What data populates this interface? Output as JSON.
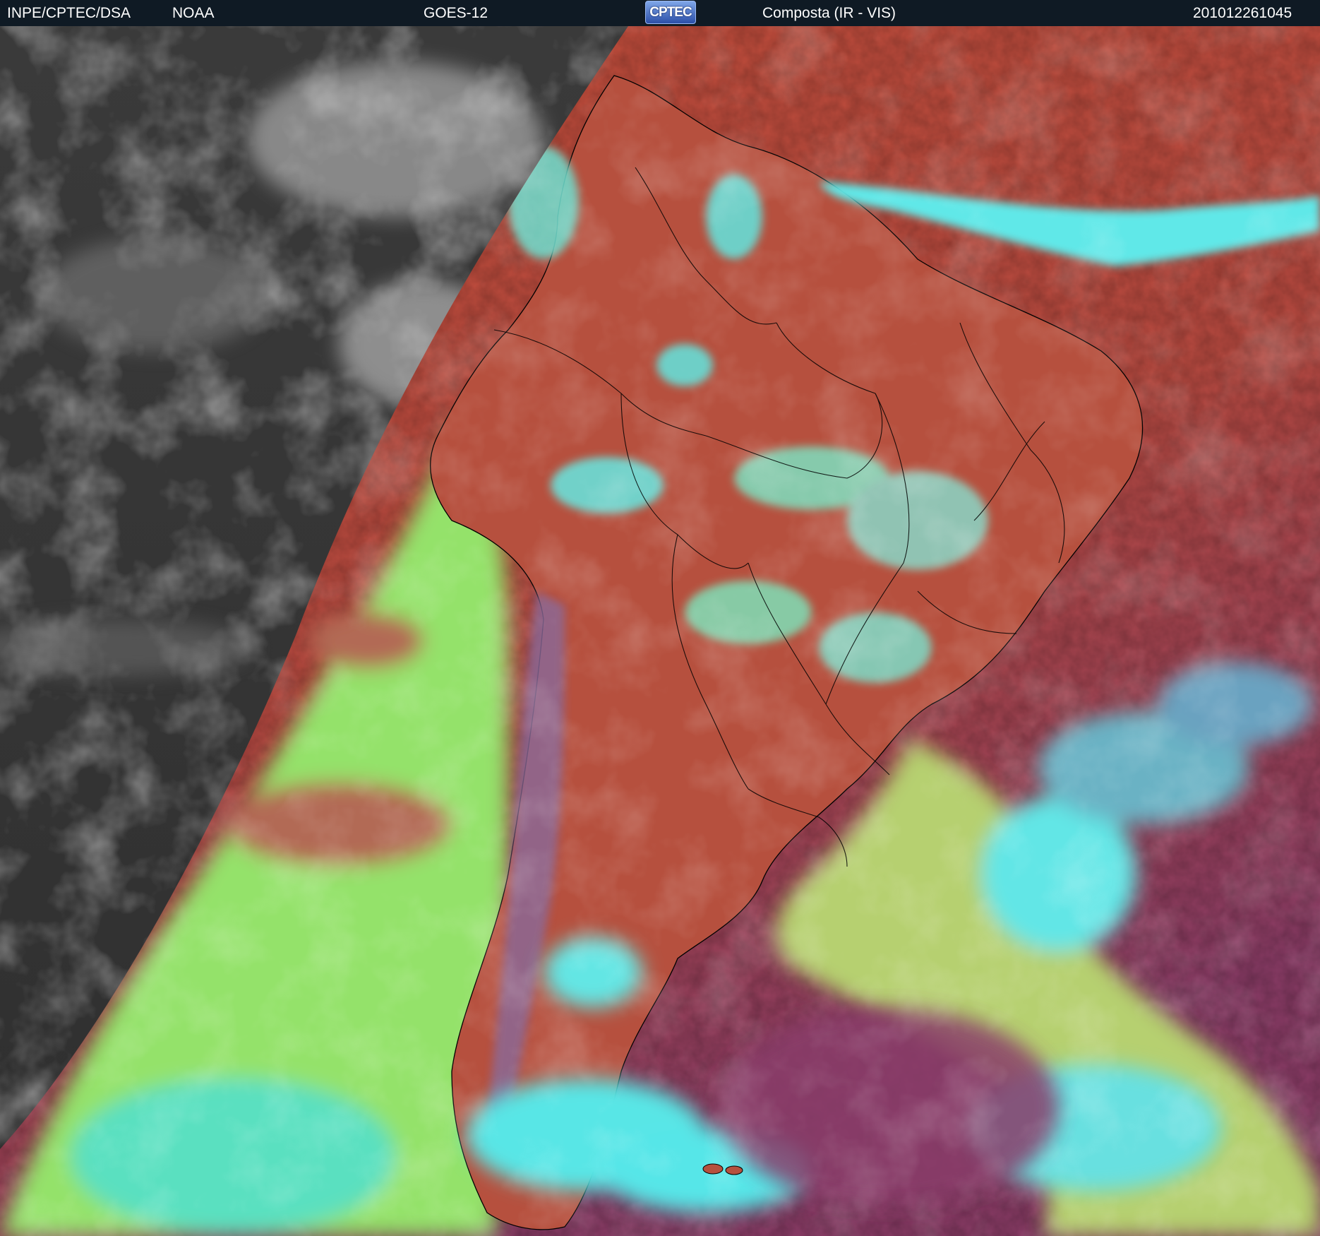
{
  "header": {
    "source": "INPE/CPTEC/DSA",
    "agency": "NOAA",
    "satellite": "GOES-12",
    "logo_text": "CPTEC",
    "product": "Composta (IR - VIS)",
    "timestamp": "201012261045"
  },
  "colors": {
    "header_bg": "#0f1a24",
    "night_ir_gray": "#3d3d3d",
    "land_clear_red": "#b4483c",
    "ocean_clear_red": "#c4503c",
    "southern_ocean_magenta": "#8a3c68",
    "low_cloud_green": "#9ae664",
    "high_cloud_cyan": "#50e8e6",
    "border_lines": "#000000"
  },
  "map": {
    "region": "South America",
    "projection": "satellite full-disk sector",
    "terminator": "day/night line separating IR-only (left, gray) from composite (right, color)"
  }
}
